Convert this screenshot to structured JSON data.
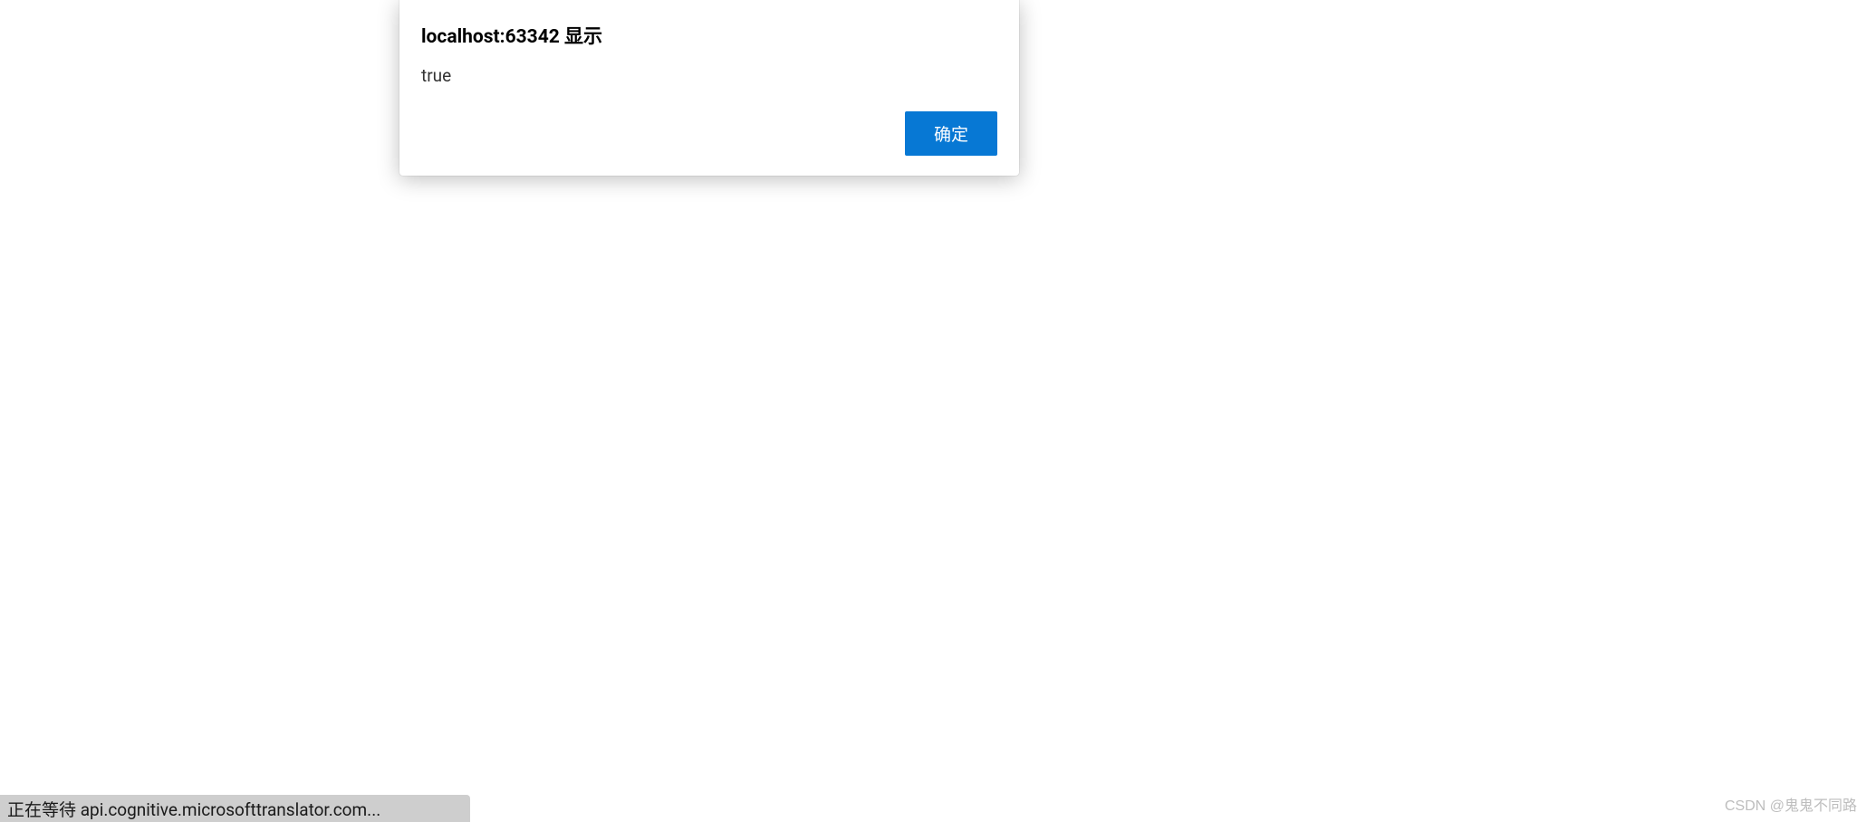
{
  "dialog": {
    "title": "localhost:63342 显示",
    "message": "true",
    "ok_label": "确定"
  },
  "status_bar": {
    "text": "正在等待 api.cognitive.microsofttranslator.com..."
  },
  "watermark": {
    "text": "CSDN @鬼鬼不同路"
  }
}
